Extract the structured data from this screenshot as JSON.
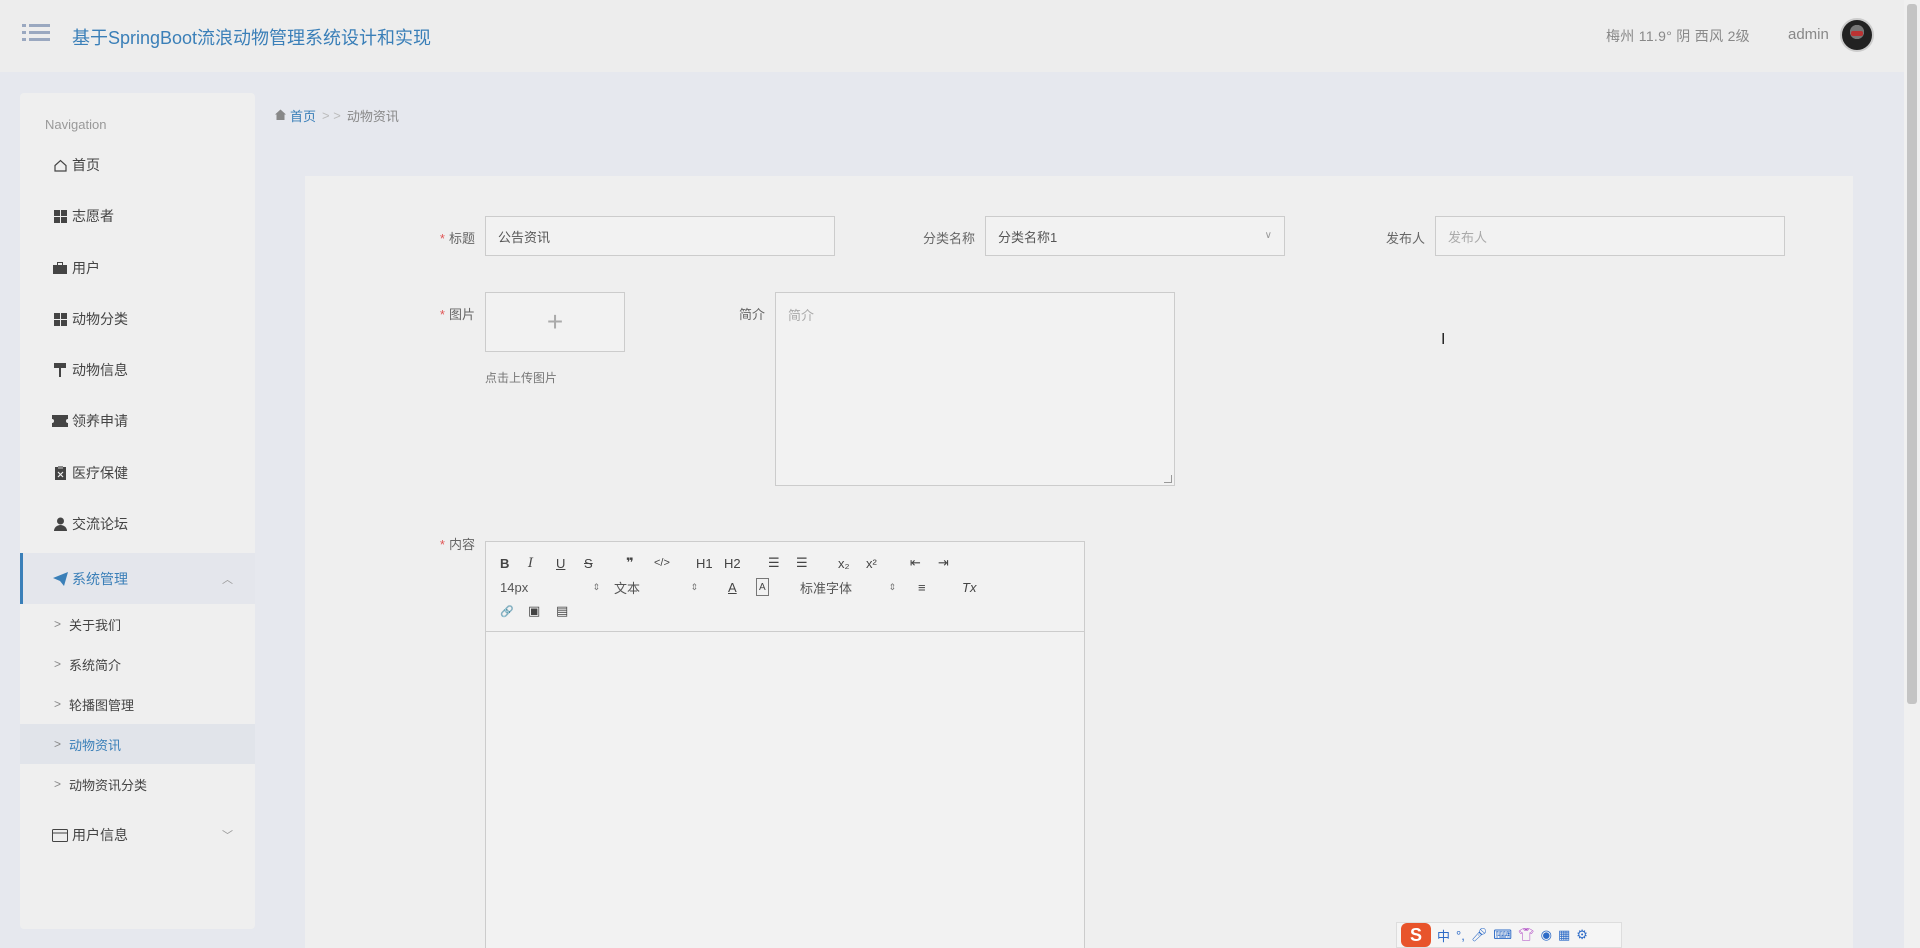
{
  "header": {
    "title": "基于SpringBoot流浪动物管理系统设计和实现",
    "weather": "梅州  11.9°  阴  西风  2级",
    "username": "admin"
  },
  "sidebar": {
    "heading": "Navigation",
    "items": [
      {
        "label": "首页",
        "icon": "home-icon"
      },
      {
        "label": "志愿者",
        "icon": "grid-icon"
      },
      {
        "label": "用户",
        "icon": "briefcase-icon"
      },
      {
        "label": "动物分类",
        "icon": "grid-icon"
      },
      {
        "label": "动物信息",
        "icon": "paint-roller-icon"
      },
      {
        "label": "领养申请",
        "icon": "ticket-icon"
      },
      {
        "label": "医疗保健",
        "icon": "clipboard-icon"
      },
      {
        "label": "交流论坛",
        "icon": "user-icon"
      },
      {
        "label": "系统管理",
        "icon": "send-icon"
      }
    ],
    "subitems": [
      "关于我们",
      "系统简介",
      "轮播图管理",
      "动物资讯",
      "动物资讯分类"
    ],
    "user_info": "用户信息"
  },
  "breadcrumb": {
    "home": "首页",
    "separator": "> >",
    "current": "动物资讯"
  },
  "form": {
    "title_label": "标题",
    "title_value": "公告资讯",
    "category_label": "分类名称",
    "category_value": "分类名称1",
    "publisher_label": "发布人",
    "publisher_placeholder": "发布人",
    "image_label": "图片",
    "upload_tip": "点击上传图片",
    "intro_label": "简介",
    "intro_placeholder": "简介",
    "content_label": "内容"
  },
  "editor": {
    "font_size": "14px",
    "format": "文本",
    "font_family": "标准字体",
    "buttons": {
      "bold": "B",
      "italic": "I",
      "underline": "U",
      "strike": "S",
      "quote": "❞",
      "code": "</>",
      "h1": "H1",
      "h2": "H2",
      "ol": "☰",
      "ul": "☰",
      "sub": "x₂",
      "sup": "x²",
      "outdent": "⇤",
      "indent": "⇥",
      "color": "A",
      "bg": "A",
      "align": "≡",
      "clear": "Tx",
      "link": "🔗",
      "image": "▣",
      "video": "▤"
    }
  },
  "ime": {
    "logo": "S",
    "mode": "中",
    "punct": "°,"
  },
  "colors": {
    "accent": "#3a7fb8",
    "required": "#e05555"
  }
}
